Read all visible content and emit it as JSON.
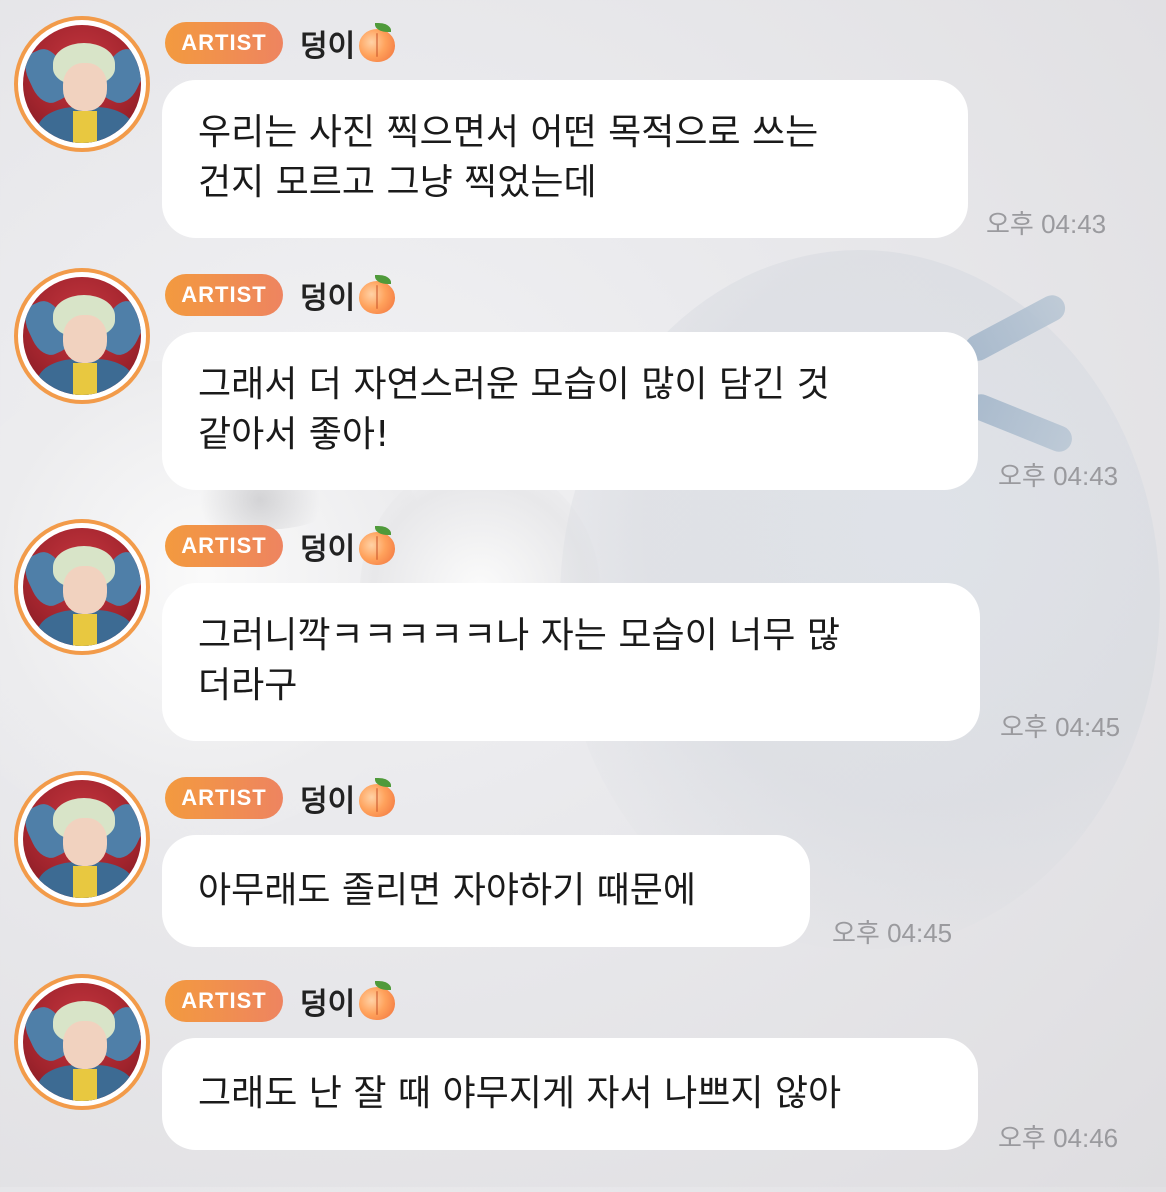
{
  "messages": [
    {
      "badge": "ARTIST",
      "sender": "덩이",
      "lines": [
        "우리는 사진 찍으면서 어떤 목적으로 쓰는",
        "건지 모르고 그냥 찍었는데"
      ],
      "time": "오후 04:43"
    },
    {
      "badge": "ARTIST",
      "sender": "덩이",
      "lines": [
        "그래서 더 자연스러운 모습이 많이 담긴 것",
        "같아서 좋아!"
      ],
      "time": "오후 04:43"
    },
    {
      "badge": "ARTIST",
      "sender": "덩이",
      "lines": [
        "그러니깍ㅋㅋㅋㅋㅋ나 자는 모습이 너무 많",
        "더라구"
      ],
      "time": "오후 04:45"
    },
    {
      "badge": "ARTIST",
      "sender": "덩이",
      "lines": [
        "아무래도 졸리면 자야하기 때문에"
      ],
      "time": "오후 04:45"
    },
    {
      "badge": "ARTIST",
      "sender": "덩이",
      "lines": [
        "그래도 난 잘 때 야무지게 자서 나쁘지 않아"
      ],
      "time": "오후 04:46"
    }
  ],
  "icons": {
    "avatar": "artist-avatar-icon",
    "emoji": "peach-icon"
  },
  "colors": {
    "badge": "#f39a3f",
    "avatar_ring": "#f29b4a",
    "bubble": "#ffffff",
    "timestamp": "#9a9a9e",
    "text": "#1a1a1a"
  }
}
